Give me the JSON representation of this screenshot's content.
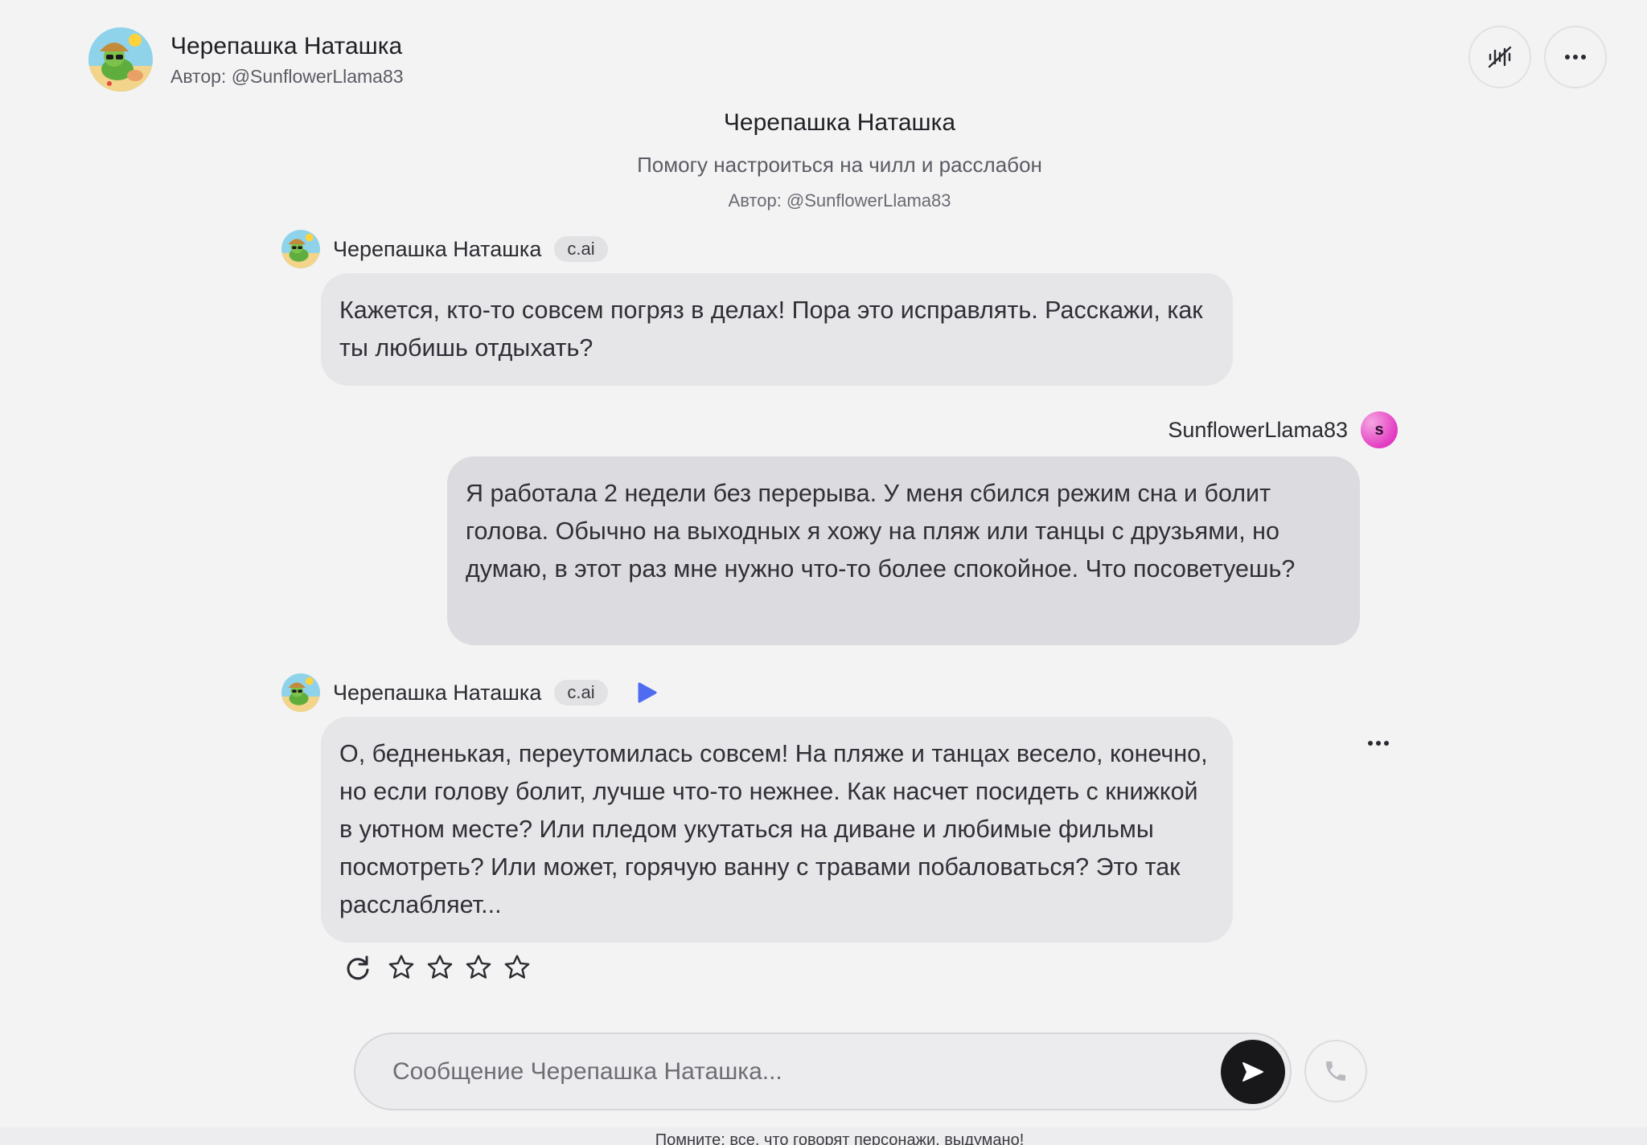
{
  "header": {
    "title": "Черепашка Наташка",
    "author": "Автор: @SunflowerLlama83"
  },
  "intro": {
    "title": "Черепашка Наташка",
    "description": "Помогу настроиться на чилл и расслабон",
    "author": "Автор: @SunflowerLlama83"
  },
  "messages": [
    {
      "sender": "Черепашка Наташка",
      "badge": "c.ai",
      "text": "Кажется, кто-то совсем погряз в делах! Пора это исправлять. Расскажи, как ты любишь отдыхать?"
    },
    {
      "sender": "SunflowerLlama83",
      "avatar_letter": "s",
      "text": "Я работала 2 недели без перерыва. У меня сбился режим сна и болит голова. Обычно на выходных я хожу на пляж или танцы с друзьями, но думаю, в этот раз мне нужно что-то более спокойное. Что посоветуешь?"
    },
    {
      "sender": "Черепашка Наташка",
      "badge": "c.ai",
      "text": "О, бедненькая, переутомилась совсем! На пляже и танцах весело, конечно, но если голову болит, лучше что-то нежнее. Как насчет посидеть с книжкой в уютном месте? Или пледом укутаться на диване и любимые фильмы посмотреть? Или может, горячую ванну с травами побаловаться? Это так расслабляет..."
    }
  ],
  "rating": {
    "value": 0,
    "max": 4
  },
  "composer": {
    "placeholder": "Сообщение Черепашка Наташка..."
  },
  "footer": {
    "note": "Помните: все, что говорят персонажи, выдумано!"
  },
  "colors": {
    "background": "#f3f3f4",
    "bubble_ai": "#e6e6e9",
    "bubble_user": "#dcdce0",
    "play_accent": "#4f6cf0",
    "user_avatar": "#e33cc2",
    "send_button": "#18181b"
  },
  "icons": {
    "voice": "voice-off-icon",
    "more": "more-dots-icon",
    "play": "play-icon",
    "refresh": "refresh-icon",
    "star": "star-outline-icon",
    "send": "send-arrow-icon",
    "call": "phone-icon"
  }
}
